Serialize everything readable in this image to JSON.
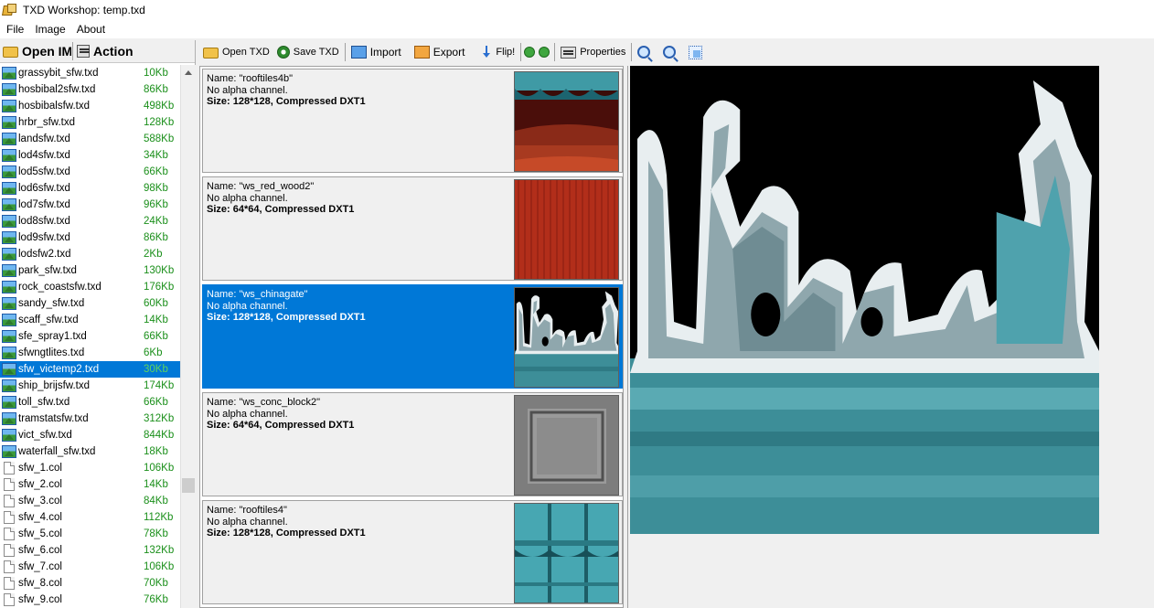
{
  "window": {
    "title": "TXD Workshop: temp.txd"
  },
  "menu": [
    "File",
    "Image",
    "About"
  ],
  "left_toolbar": {
    "open_img": "Open IMG",
    "action": "Action"
  },
  "files": [
    {
      "name": "grassybit_sfw.txd",
      "size": "10Kb",
      "icon": "image-icon"
    },
    {
      "name": "hosbibal2sfw.txd",
      "size": "86Kb",
      "icon": "image-icon"
    },
    {
      "name": "hosbibalsfw.txd",
      "size": "498Kb",
      "icon": "image-icon"
    },
    {
      "name": "hrbr_sfw.txd",
      "size": "128Kb",
      "icon": "image-icon"
    },
    {
      "name": "landsfw.txd",
      "size": "588Kb",
      "icon": "image-icon"
    },
    {
      "name": "lod4sfw.txd",
      "size": "34Kb",
      "icon": "image-icon"
    },
    {
      "name": "lod5sfw.txd",
      "size": "66Kb",
      "icon": "image-icon"
    },
    {
      "name": "lod6sfw.txd",
      "size": "98Kb",
      "icon": "image-icon"
    },
    {
      "name": "lod7sfw.txd",
      "size": "96Kb",
      "icon": "image-icon"
    },
    {
      "name": "lod8sfw.txd",
      "size": "24Kb",
      "icon": "image-icon"
    },
    {
      "name": "lod9sfw.txd",
      "size": "86Kb",
      "icon": "image-icon"
    },
    {
      "name": "lodsfw2.txd",
      "size": "2Kb",
      "icon": "image-icon"
    },
    {
      "name": "park_sfw.txd",
      "size": "130Kb",
      "icon": "image-icon"
    },
    {
      "name": "rock_coastsfw.txd",
      "size": "176Kb",
      "icon": "image-icon"
    },
    {
      "name": "sandy_sfw.txd",
      "size": "60Kb",
      "icon": "image-icon"
    },
    {
      "name": "scaff_sfw.txd",
      "size": "14Kb",
      "icon": "image-icon"
    },
    {
      "name": "sfe_spray1.txd",
      "size": "66Kb",
      "icon": "image-icon"
    },
    {
      "name": "sfwngtlites.txd",
      "size": "6Kb",
      "icon": "image-icon"
    },
    {
      "name": "sfw_victemp2.txd",
      "size": "30Kb",
      "icon": "image-icon",
      "selected": true
    },
    {
      "name": "ship_brijsfw.txd",
      "size": "174Kb",
      "icon": "image-icon"
    },
    {
      "name": "toll_sfw.txd",
      "size": "66Kb",
      "icon": "image-icon"
    },
    {
      "name": "tramstatsfw.txd",
      "size": "312Kb",
      "icon": "image-icon"
    },
    {
      "name": "vict_sfw.txd",
      "size": "844Kb",
      "icon": "image-icon"
    },
    {
      "name": "waterfall_sfw.txd",
      "size": "18Kb",
      "icon": "image-icon"
    },
    {
      "name": "sfw_1.col",
      "size": "106Kb",
      "icon": "document-icon"
    },
    {
      "name": "sfw_2.col",
      "size": "14Kb",
      "icon": "document-icon"
    },
    {
      "name": "sfw_3.col",
      "size": "84Kb",
      "icon": "document-icon"
    },
    {
      "name": "sfw_4.col",
      "size": "112Kb",
      "icon": "document-icon"
    },
    {
      "name": "sfw_5.col",
      "size": "78Kb",
      "icon": "document-icon"
    },
    {
      "name": "sfw_6.col",
      "size": "132Kb",
      "icon": "document-icon"
    },
    {
      "name": "sfw_7.col",
      "size": "106Kb",
      "icon": "document-icon"
    },
    {
      "name": "sfw_8.col",
      "size": "70Kb",
      "icon": "document-icon"
    },
    {
      "name": "sfw_9.col",
      "size": "76Kb",
      "icon": "document-icon"
    }
  ],
  "toolbar": {
    "open_txd": "Open TXD",
    "save_txd": "Save TXD",
    "import": "Import",
    "export": "Export",
    "flip": "Flip!",
    "properties": "Properties"
  },
  "textures": [
    {
      "name": "Name: \"rooftiles4b\"",
      "alpha": "No alpha channel.",
      "size": "Size: 128*128, Compressed DXT1",
      "thumb": "rooftiles-dark"
    },
    {
      "name": "Name: \"ws_red_wood2\"",
      "alpha": "No alpha channel.",
      "size": "Size: 64*64, Compressed DXT1",
      "thumb": "red-wood"
    },
    {
      "name": "Name: \"ws_chinagate\"",
      "alpha": "No alpha channel.",
      "size": "Size: 128*128, Compressed DXT1",
      "thumb": "chinagate",
      "selected": true
    },
    {
      "name": "Name: \"ws_conc_block2\"",
      "alpha": "No alpha channel.",
      "size": "Size: 64*64, Compressed DXT1",
      "thumb": "concrete"
    },
    {
      "name": "Name: \"rooftiles4\"",
      "alpha": "No alpha channel.",
      "size": "Size: 128*128, Compressed DXT1",
      "thumb": "rooftiles-teal"
    }
  ],
  "colors": {
    "selection": "#0078d7",
    "size_text": "#1a8f1a",
    "teal": "#4aa6b0",
    "red_wood": "#b0301c"
  }
}
